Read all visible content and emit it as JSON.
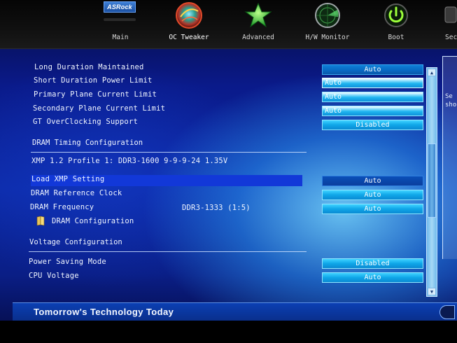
{
  "brand": {
    "logo_text": "ASRock"
  },
  "nav": [
    {
      "label": "Main",
      "icon": "asrock-logo-icon"
    },
    {
      "label": "OC Tweaker",
      "icon": "oc-tweaker-icon"
    },
    {
      "label": "Advanced",
      "icon": "star-icon"
    },
    {
      "label": "H/W Monitor",
      "icon": "radar-icon"
    },
    {
      "label": "Boot",
      "icon": "power-icon"
    },
    {
      "label": "Sec",
      "icon": "security-icon"
    }
  ],
  "settings": {
    "long_duration_maintained": {
      "label": "Long Duration Maintained",
      "value": "Auto"
    },
    "short_duration_power_limit": {
      "label": "Short Duration Power Limit",
      "value": "Auto"
    },
    "primary_plane_current_limit": {
      "label": "Primary Plane Current Limit",
      "value": "Auto"
    },
    "secondary_plane_current_limit": {
      "label": "Secondary Plane Current Limit",
      "value": "Auto"
    },
    "gt_overclocking_support": {
      "label": "GT OverClocking Support",
      "value": "Disabled"
    },
    "dram_timing_title": "DRAM Timing Configuration",
    "xmp_profile_info": "XMP 1.2 Profile 1: DDR3-1600 9-9-9-24 1.35V",
    "load_xmp_setting": {
      "label": "Load XMP Setting",
      "value": "Auto"
    },
    "dram_reference_clock": {
      "label": "DRAM Reference Clock",
      "value": "Auto"
    },
    "dram_frequency": {
      "label": "DRAM Frequency",
      "info": "DDR3-1333 (1:5)",
      "value": "Auto"
    },
    "dram_configuration": {
      "label": "DRAM Configuration"
    },
    "voltage_title": "Voltage Configuration",
    "power_saving_mode": {
      "label": "Power Saving Mode",
      "value": "Disabled"
    },
    "cpu_voltage": {
      "label": "CPU Voltage",
      "value": "Auto"
    }
  },
  "help": {
    "line1": "Se",
    "line2": "sho"
  },
  "footer": {
    "slogan": "Tomorrow's Technology Today"
  },
  "colors": {
    "accent": "#1238d8",
    "value_box": "#0fa6e8",
    "background": "#0c2aa8"
  }
}
